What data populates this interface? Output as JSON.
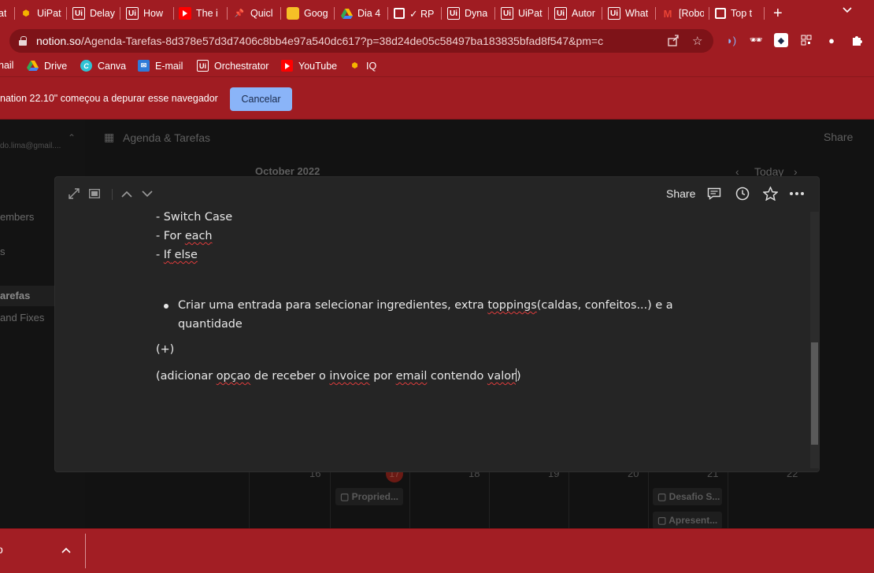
{
  "browser": {
    "tabs": [
      {
        "label": "at",
        "icon": "chat-icon"
      },
      {
        "label": "UiPat",
        "icon": "uipath-shield-icon"
      },
      {
        "label": "Delay",
        "icon": "uipath-icon"
      },
      {
        "label": "How",
        "icon": "uipath-icon"
      },
      {
        "label": "The i",
        "icon": "youtube-icon"
      },
      {
        "label": "Quicl",
        "icon": "pin-icon"
      },
      {
        "label": "Goog",
        "icon": "keep-icon"
      },
      {
        "label": "Dia 4",
        "icon": "drive-icon"
      },
      {
        "label": "✓ RP",
        "icon": "globe-icon"
      },
      {
        "label": "Dyna",
        "icon": "uipath-icon"
      },
      {
        "label": "UiPat",
        "icon": "uipath-icon"
      },
      {
        "label": "Autor",
        "icon": "uipath-icon"
      },
      {
        "label": "What",
        "icon": "uipath-icon"
      },
      {
        "label": "[Robo",
        "icon": "gmail-icon"
      },
      {
        "label": "Top t",
        "icon": "globe-icon"
      }
    ],
    "new_tab": "+",
    "url_host": "notion.so",
    "url_path": "/Agenda-Tarefas-8d378e57d3d7406c8bb4e97a540dc617?p=38d24de05c58497ba183835bfad8f547&pm=c",
    "bookmarks": [
      {
        "label": "nail",
        "icon": "gmail-icon"
      },
      {
        "label": "Drive",
        "icon": "drive-icon"
      },
      {
        "label": "Canva",
        "icon": "canva-icon"
      },
      {
        "label": "E-mail",
        "icon": "mail-icon"
      },
      {
        "label": "Orchestrator",
        "icon": "uipath-icon"
      },
      {
        "label": "YouTube",
        "icon": "youtube-icon"
      },
      {
        "label": "IQ",
        "icon": "iq-icon"
      }
    ],
    "infobar_text": "nation 22.10\" começou a depurar esse navegador",
    "infobar_button": "Cancelar"
  },
  "notion_bg": {
    "workspace_email": "do.lima@gmail....",
    "page_title": "Agenda & Tarefas",
    "share_label": "Share",
    "month_label": "October 2022",
    "today_label": "Today",
    "sidebar_items": [
      "embers",
      "s",
      "arefas",
      "and Fixes"
    ],
    "calendar_days": [
      "16",
      "17",
      "18",
      "19",
      "20",
      "21",
      "22"
    ],
    "cards": [
      {
        "label": "Propried..."
      },
      {
        "label": "Desafio S..."
      },
      {
        "label": "Apresent..."
      }
    ]
  },
  "modal": {
    "share_label": "Share",
    "lines": {
      "switch_case": "- Switch Case",
      "for_each_prefix": "- For ",
      "for_each_word": "each",
      "if_prefix": "- ",
      "if_word": "If",
      "if_suffix": " else",
      "bullet_1_a": "Criar uma entrada para selecionar ingredientes, extra ",
      "bullet_1_word": "toppings",
      "bullet_1_b": "(caldas, confeitos...) e a",
      "bullet_1_line2": "quantidade",
      "plus": "(+)",
      "last_a": "(adicionar ",
      "last_w1": "opçao",
      "last_b": " de receber o ",
      "last_w2": "invoice",
      "last_c": " por ",
      "last_w3": "email",
      "last_d": " contendo ",
      "last_w4": "valor",
      "last_e": ")"
    }
  },
  "taskbar": {
    "left_char": "o",
    "up_arrow": "^"
  }
}
